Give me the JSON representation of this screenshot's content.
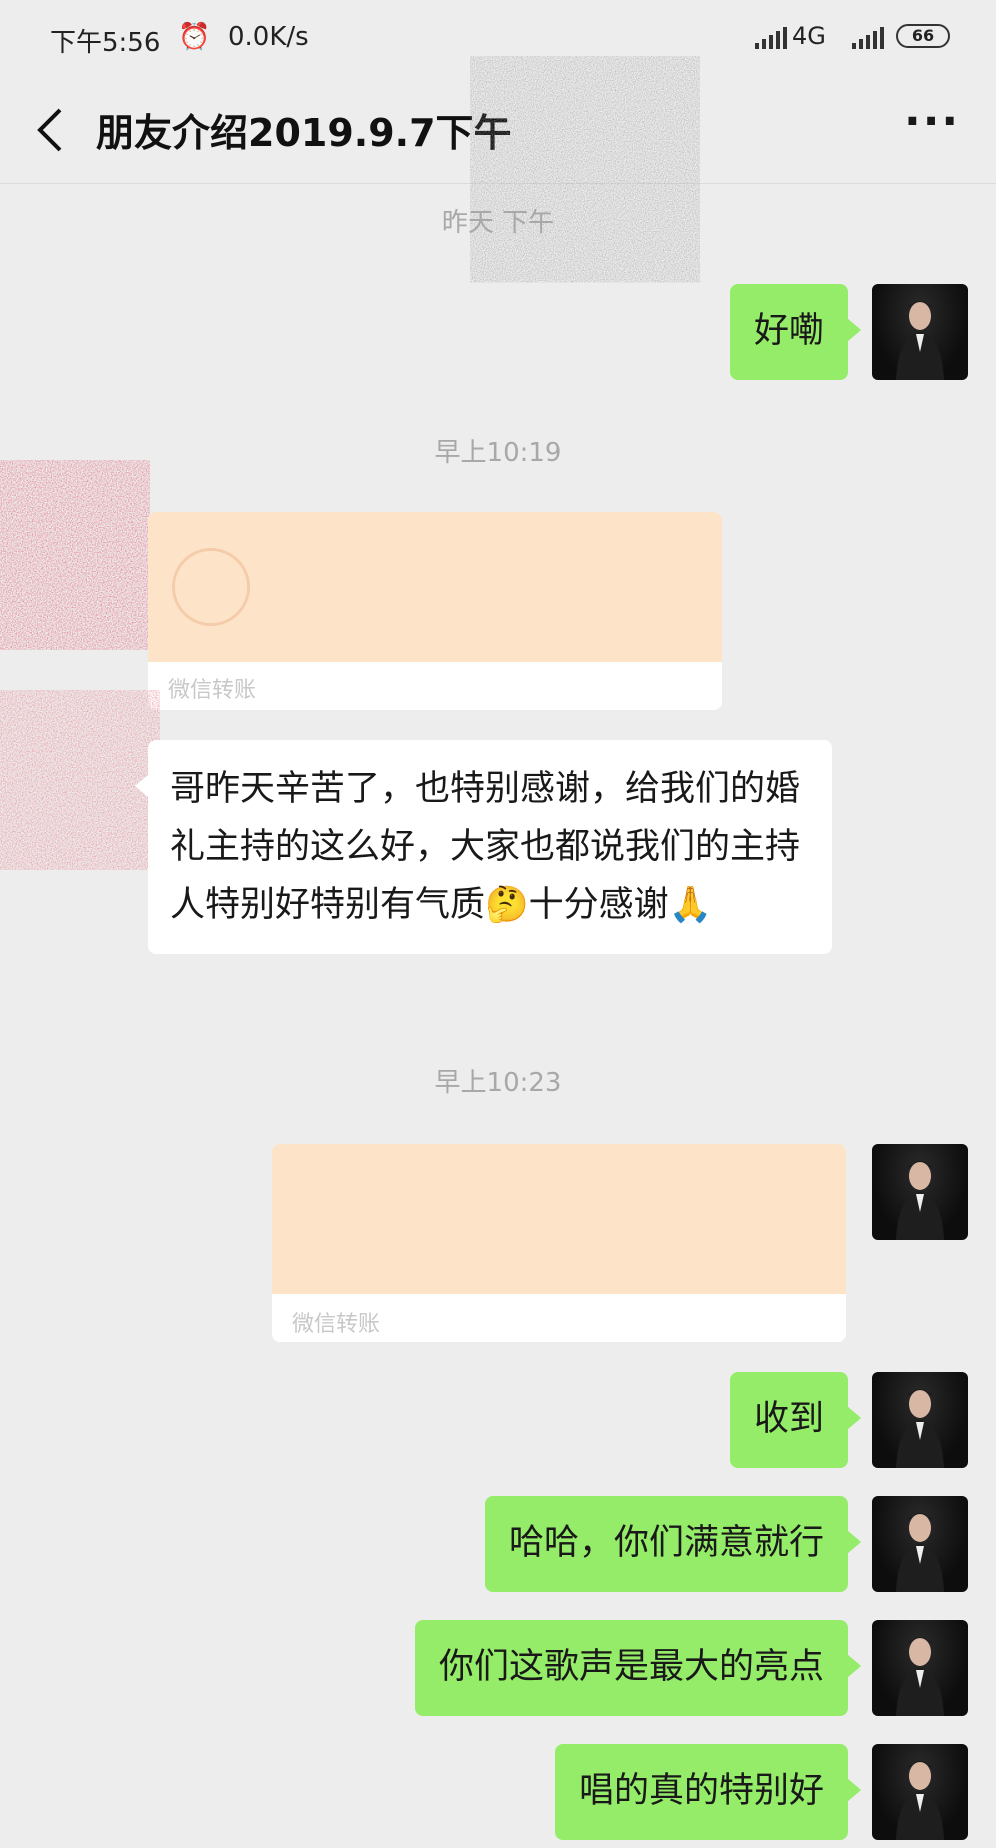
{
  "status_bar": {
    "time": "下午5:56",
    "alarm_icon": "⏰",
    "speed": "0.0K/s",
    "network": "4G",
    "battery": "66"
  },
  "header": {
    "title": "朋友介绍2019.9.7下午",
    "more": "···"
  },
  "messages": {
    "ts1": "昨天 下午",
    "msg1": "好嘞",
    "ts2": "早上10:19",
    "transfer1_label": "微信转账",
    "msg2": "哥昨天辛苦了，也特别感谢，给我们的婚礼主持的这么好，大家也都说我们的主持人特别好特别有气质🤔十分感谢🙏",
    "ts3": "早上10:23",
    "transfer2_label": "微信转账",
    "msg3": "收到",
    "msg4": "哈哈，你们满意就行",
    "msg5": "你们这歌声是最大的亮点",
    "msg6": "唱的真的特别好"
  },
  "colors": {
    "background": "#ededed",
    "my_bubble": "#95ec69",
    "their_bubble": "#ffffff",
    "transfer_top": "#fde4c9",
    "timestamp": "#a8a8a8"
  }
}
